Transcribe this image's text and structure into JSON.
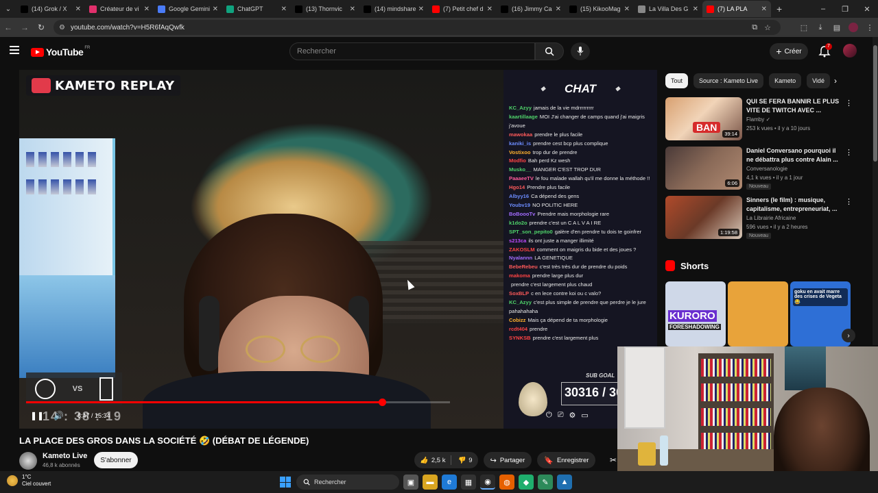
{
  "browser": {
    "tabs": [
      {
        "title": "(14) Grok / X",
        "favicon": "x-icon",
        "color": "#000000"
      },
      {
        "title": "Créateur de vi",
        "favicon": "instagram-icon",
        "color": "#e1306c"
      },
      {
        "title": "Google Gemini",
        "favicon": "gemini-icon",
        "color": "#4a7bf7"
      },
      {
        "title": "ChatGPT",
        "favicon": "chatgpt-icon",
        "color": "#10a37f"
      },
      {
        "title": "(13) Thorn­vic",
        "favicon": "x-icon",
        "color": "#000000"
      },
      {
        "title": "(14) mindshare",
        "favicon": "x-icon",
        "color": "#000000"
      },
      {
        "title": "(7) Petit chef d",
        "favicon": "youtube-icon",
        "color": "#ff0000"
      },
      {
        "title": "(16) Jimmy Ca",
        "favicon": "x-icon",
        "color": "#000000"
      },
      {
        "title": "(15) KikooMag",
        "favicon": "x-icon",
        "color": "#000000"
      },
      {
        "title": "La Villa Des G",
        "favicon": "globe-icon",
        "color": "#888888"
      },
      {
        "title": "(7) LA PLA",
        "favicon": "youtube-icon",
        "color": "#ff0000",
        "active": true
      }
    ],
    "url": "youtube.com/watch?v=H5R6fAqQwfk"
  },
  "youtube": {
    "logo_text": "YouTube",
    "region": "FR",
    "search_placeholder": "Rechercher",
    "create_label": "Créer",
    "notif_count": "7"
  },
  "video": {
    "overlay_brand": "KAMETO REPLAY",
    "overlay_vs": "VS",
    "overlay_timer": "14 : 38 : 19",
    "current_time": "8:47 / 15:34",
    "progress": 0.84,
    "title": "LA PLACE DES GROS DANS LA SOCIÉTÉ 🤣 (DÉBAT DE LÉGENDE)",
    "channel": "Kameto Live",
    "subscribers": "46,8 k abonnés",
    "subscribe_label": "S'abonner",
    "likes": "2,5 k",
    "dislikes": "9",
    "share_label": "Partager",
    "save_label": "Enregistrer"
  },
  "chat": {
    "title": "CHAT",
    "lines": [
      {
        "user": "KC_Azyy",
        "color": "#4fd36a",
        "text": "jamais de la vie mdrrrrrrrrr"
      },
      {
        "user": "kaartillaage",
        "color": "#4fd36a",
        "text": "MOI J'ai changer de camps quand j'ai maigris j'avoue"
      },
      {
        "user": "mawokaa",
        "color": "#ff5a5a",
        "text": "prendre le plus facile"
      },
      {
        "user": "kaniki_is",
        "color": "#6c8cff",
        "text": "prendre cest bcp plus complique"
      },
      {
        "user": "Vostixoo",
        "color": "#ffb22e",
        "text": "trop dur de prendre"
      },
      {
        "user": "Modfio",
        "color": "#ff4444",
        "text": "Bah perd Kz wesh"
      },
      {
        "user": "Musko__",
        "color": "#4fd36a",
        "text": "MANGER C'EST TROP DUR"
      },
      {
        "user": "PaaaeeTV",
        "color": "#ff5a9a",
        "text": "le fou malade wallah qu'il me donne la méthode !!"
      },
      {
        "user": "Hgo14",
        "color": "#ff5a5a",
        "text": "Prendre plus facile"
      },
      {
        "user": "Albyy16",
        "color": "#6c8cff",
        "text": "Ca dépend des gens"
      },
      {
        "user": "Youbv19",
        "color": "#6c8cff",
        "text": "NO POLITIC HERE"
      },
      {
        "user": "BoBoooTv",
        "color": "#a36cff",
        "text": "Prendre mais morphologie rare"
      },
      {
        "user": "k1do2o",
        "color": "#4fd36a",
        "text": "prendre c'est un C A L V A I RE"
      },
      {
        "user": "SPT_son_pepito0",
        "color": "#4fd36a",
        "text": "galère d'en prendre tu dois te goinfrer"
      },
      {
        "user": "s213ca",
        "color": "#c04cff",
        "text": "ils ont juste a manger illimité"
      },
      {
        "user": "ZAKOSLM",
        "color": "#ff4444",
        "text": "comment on maigris du bide et des joues ?"
      },
      {
        "user": "Nyalannn",
        "color": "#a36cff",
        "text": "LA GENETIQUE"
      },
      {
        "user": "BebeRebeu",
        "color": "#ff5a5a",
        "text": "c'est très très dur de prendre du poids"
      },
      {
        "user": "makoma",
        "color": "#ff4444",
        "text": "prendre large plus dur"
      },
      {
        "user": "",
        "color": "#ffb22e",
        "text": "prendre c'est largement plus chaud"
      },
      {
        "user": "SoxBLP",
        "color": "#ff5a5a",
        "text": "c en lece contre koi ou c valo?"
      },
      {
        "user": "KC_Azyy",
        "color": "#4fd36a",
        "text": "c'est plus simple de prendre que perdre je le jure pahahahaha"
      },
      {
        "user": "Cobizz",
        "color": "#ffb22e",
        "text": "Mais ça dépend de ta morphologie"
      },
      {
        "user": "rcdt404",
        "color": "#ff4444",
        "text": "prendre"
      },
      {
        "user": "SYNKSB",
        "color": "#ff4444",
        "text": "prendre c'est largement plus"
      }
    ],
    "sub_goal_label": "SUB GOAL",
    "sub_goal_value": "30316 / 30"
  },
  "sidebar": {
    "chips": [
      "Tout",
      "Source : Kameto Live",
      "Kameto",
      "Vidé"
    ],
    "recommendations": [
      {
        "title": "QUI SE FERA BANNIR LE PLUS VITE DE TWITCH AVEC ...",
        "channel": "Flamby ✓",
        "meta": "253 k vues • il y a 10 jours",
        "duration": "39:14",
        "thumb_text": "BAN",
        "new": ""
      },
      {
        "title": "Daniel Conversano pourquoi il ne débattra plus contre Alain ...",
        "channel": "Conversanologie",
        "meta": "4,1 k vues • il y a 1 jour",
        "duration": "6:06",
        "thumb_text": "",
        "new": "Nouveau"
      },
      {
        "title": "Sinners (le film) : musique, capitalisme, entrepreneuriat, ...",
        "channel": "La Librairie Africaine",
        "meta": "596 vues • il y a 2 heures",
        "duration": "1:19:58",
        "thumb_text": "",
        "new": "Nouveau"
      }
    ],
    "shorts_title": "Shorts",
    "shorts": [
      {
        "text": "KURORO",
        "sub": "FORESHADOWING",
        "bg": "#cfd8e8"
      },
      {
        "text": "",
        "sub": "",
        "bg": "#e8a33a"
      },
      {
        "text": "goku en avait marre des crises de Vegeta 😂",
        "sub": "",
        "bg": "#2e6fd6"
      }
    ]
  },
  "taskbar": {
    "temperature": "1°C",
    "weather": "Ciel couvert",
    "search_label": "Rechercher"
  },
  "colors": {
    "accent": "#ff0000",
    "bg": "#0f0f0f",
    "chip_bg": "#272727"
  }
}
